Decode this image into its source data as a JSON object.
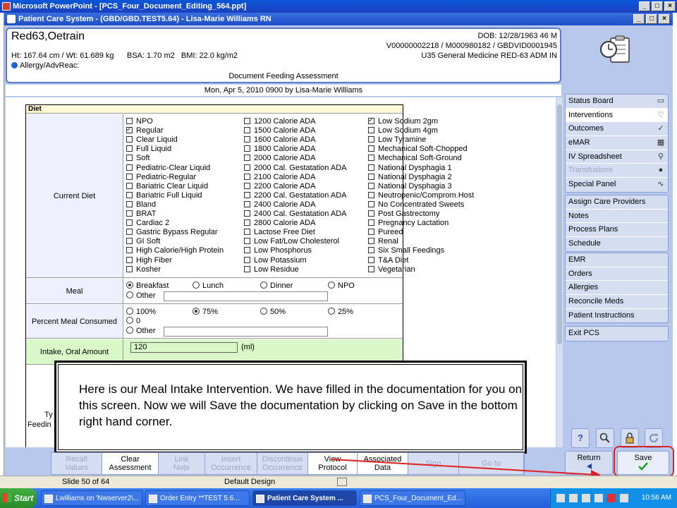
{
  "ppt_window": {
    "title": "Microsoft PowerPoint - [PCS_Four_Document_Editing_564.ppt]"
  },
  "app_window": {
    "title": "Patient Care System - (GBD/GBD.TEST5.64) - Lisa-Marie Williams RN"
  },
  "patient": {
    "name": "Red63,Oetrain",
    "stats": "Ht: 167.64 cm / Wt: 61.689 kg      BSA: 1.70 m2   BMI: 22.0 kg/m2",
    "allergy": "Allergy/AdvReac:",
    "dob": "DOB: 12/28/1963 46 M",
    "ids": "V00000002218 / M000980182 / GBDVID0001945",
    "location": "U35 General Medicine  RED-63  ADM IN"
  },
  "document": {
    "title": "Document Feeding Assessment",
    "date_line": "Mon,  Apr 5, 2010 0900  by  Lisa-Marie Williams"
  },
  "diet": {
    "section_label": "Diet",
    "current_diet_label": "Current Diet",
    "col1": [
      {
        "label": "NPO",
        "checked": false
      },
      {
        "label": "Regular",
        "checked": true
      },
      {
        "label": "Clear Liquid",
        "checked": false
      },
      {
        "label": "Full Liquid",
        "checked": false
      },
      {
        "label": "Soft",
        "checked": false
      },
      {
        "label": "Pediatric-Clear Liquid",
        "checked": false
      },
      {
        "label": "Pediatric-Regular",
        "checked": false
      },
      {
        "label": "Bariatric Clear Liquid",
        "checked": false
      },
      {
        "label": "Bariatric Full Liquid",
        "checked": false
      },
      {
        "label": "Bland",
        "checked": false
      },
      {
        "label": "BRAT",
        "checked": false
      },
      {
        "label": "Cardiac 2",
        "checked": false
      },
      {
        "label": "Gastric Bypass Regular",
        "checked": false
      },
      {
        "label": "GI Soft",
        "checked": false
      },
      {
        "label": "High Calorie/High Protein",
        "checked": false
      },
      {
        "label": "High Fiber",
        "checked": false
      },
      {
        "label": "Kosher",
        "checked": false
      }
    ],
    "col2": [
      {
        "label": "1200 Calorie ADA",
        "checked": false
      },
      {
        "label": "1500 Calorie ADA",
        "checked": false
      },
      {
        "label": "1600 Calorie ADA",
        "checked": false
      },
      {
        "label": "1800 Calorie ADA",
        "checked": false
      },
      {
        "label": "2000 Calorie ADA",
        "checked": false
      },
      {
        "label": "2000 Cal. Gestatation ADA",
        "checked": false
      },
      {
        "label": "2100 Calorie ADA",
        "checked": false
      },
      {
        "label": "2200 Calorie ADA",
        "checked": false
      },
      {
        "label": "2200 Cal. Gestatation ADA",
        "checked": false
      },
      {
        "label": "2400 Calorie ADA",
        "checked": false
      },
      {
        "label": "2400 Cal. Gestatation ADA",
        "checked": false
      },
      {
        "label": "2800 Calorie ADA",
        "checked": false
      },
      {
        "label": "Lactose Free Diet",
        "checked": false
      },
      {
        "label": "Low Fat/Low Cholesterol",
        "checked": false
      },
      {
        "label": "Low Phosphorus",
        "checked": false
      },
      {
        "label": "Low Potassium",
        "checked": false
      },
      {
        "label": "Low Residue",
        "checked": false
      }
    ],
    "col3": [
      {
        "label": "Low Sodium 2gm",
        "checked": true
      },
      {
        "label": "Low Sodium 4gm",
        "checked": false
      },
      {
        "label": "Low Tyramine",
        "checked": false
      },
      {
        "label": "Mechanical Soft-Chopped",
        "checked": false
      },
      {
        "label": "Mechanical Soft-Ground",
        "checked": false
      },
      {
        "label": "National Dysphagia 1",
        "checked": false
      },
      {
        "label": "National Dysphagia 2",
        "checked": false
      },
      {
        "label": "National Dysphagia 3",
        "checked": false
      },
      {
        "label": "Neutropenic/Comprom.Host",
        "checked": false
      },
      {
        "label": "No Concentrated Sweets",
        "checked": false
      },
      {
        "label": "Post Gastrectomy",
        "checked": false
      },
      {
        "label": "Pregnancy Lactation",
        "checked": false
      },
      {
        "label": "Pureed",
        "checked": false
      },
      {
        "label": "Renal",
        "checked": false
      },
      {
        "label": "Six Small Feedings",
        "checked": false
      },
      {
        "label": "T&A Diet",
        "checked": false
      },
      {
        "label": "Vegetarian",
        "checked": false
      }
    ],
    "meal": {
      "label": "Meal",
      "options": [
        {
          "label": "Breakfast",
          "selected": true
        },
        {
          "label": "Lunch",
          "selected": false
        },
        {
          "label": "Dinner",
          "selected": false
        },
        {
          "label": "NPO",
          "selected": false
        }
      ],
      "other_label": "Other"
    },
    "percent": {
      "label": "Percent Meal Consumed",
      "options": [
        {
          "label": "100%",
          "selected": false
        },
        {
          "label": "75%",
          "selected": true
        },
        {
          "label": "50%",
          "selected": false
        },
        {
          "label": "25%",
          "selected": false
        }
      ],
      "zero_label": "0",
      "other_label": "Other"
    },
    "intake": {
      "label": "Intake, Oral Amount",
      "value": "120",
      "unit": "(ml)"
    }
  },
  "callout": {
    "text": "Here is our Meal Intake Intervention. We have filled in the documentation for you on this screen. Now we will Save the documentation by clicking on Save in the bottom right hand corner.",
    "partial_label_1": "Ty",
    "partial_label_2": "Feedin"
  },
  "nav": {
    "group1": [
      {
        "label": "Status Board",
        "icon": "book-icon",
        "state": "normal"
      },
      {
        "label": "Interventions",
        "icon": "stethoscope-icon",
        "state": "active"
      },
      {
        "label": "Outcomes",
        "icon": "checklist-icon",
        "state": "normal"
      },
      {
        "label": "eMAR",
        "icon": "calendar-icon",
        "state": "normal"
      },
      {
        "label": "IV Spreadsheet",
        "icon": "iv-icon",
        "state": "normal"
      },
      {
        "label": "Transfusions",
        "icon": "blood-drop-icon",
        "state": "disabled"
      },
      {
        "label": "Special Panel",
        "icon": "pulse-icon",
        "state": "normal"
      }
    ],
    "group2": [
      {
        "label": "Assign Care Providers"
      },
      {
        "label": "Notes"
      },
      {
        "label": "Process Plans"
      },
      {
        "label": "Schedule"
      }
    ],
    "group3": [
      {
        "label": "EMR"
      },
      {
        "label": "Orders"
      },
      {
        "label": "Allergies"
      },
      {
        "label": "Reconcile Meds"
      },
      {
        "label": "Patient Instructions"
      }
    ],
    "group4": [
      {
        "label": "Exit PCS"
      }
    ]
  },
  "toolbar": {
    "help": "?",
    "buttons": [
      "help-icon",
      "search-icon",
      "lock-icon",
      "refresh-icon"
    ]
  },
  "bottom_bar": [
    {
      "label": "Recall\nValues",
      "enabled": false,
      "w": 72
    },
    {
      "label": "Clear\nAssessment",
      "enabled": true,
      "w": 80
    },
    {
      "label": "Link\nNote",
      "enabled": false,
      "w": 66
    },
    {
      "label": "Insert\nOccurrence",
      "enabled": false,
      "w": 74
    },
    {
      "label": "Discontinue\nOccurrence",
      "enabled": false,
      "w": 72
    },
    {
      "label": "View\nProtocol",
      "enabled": true,
      "w": 70
    },
    {
      "label": "Associated\nData",
      "enabled": true,
      "w": 72
    },
    {
      "label": "Sign",
      "enabled": false,
      "w": 72
    },
    {
      "label": "Go to",
      "enabled": false,
      "w": 92
    }
  ],
  "actions": {
    "return_label": "Return",
    "save_label": "Save"
  },
  "status_bar": {
    "slide": "Slide 50 of 64",
    "design": "Default Design"
  },
  "taskbar": {
    "start": "Start",
    "tasks": [
      {
        "label": "Lwilliams on 'Nwserver2\\...",
        "active": false
      },
      {
        "label": "Order Entry **TEST 5.6...",
        "active": false
      },
      {
        "label": "Patient Care System ...",
        "active": true
      },
      {
        "label": "PCS_Four_Document_Ed...",
        "active": false
      }
    ],
    "clock": "10:56 AM"
  }
}
